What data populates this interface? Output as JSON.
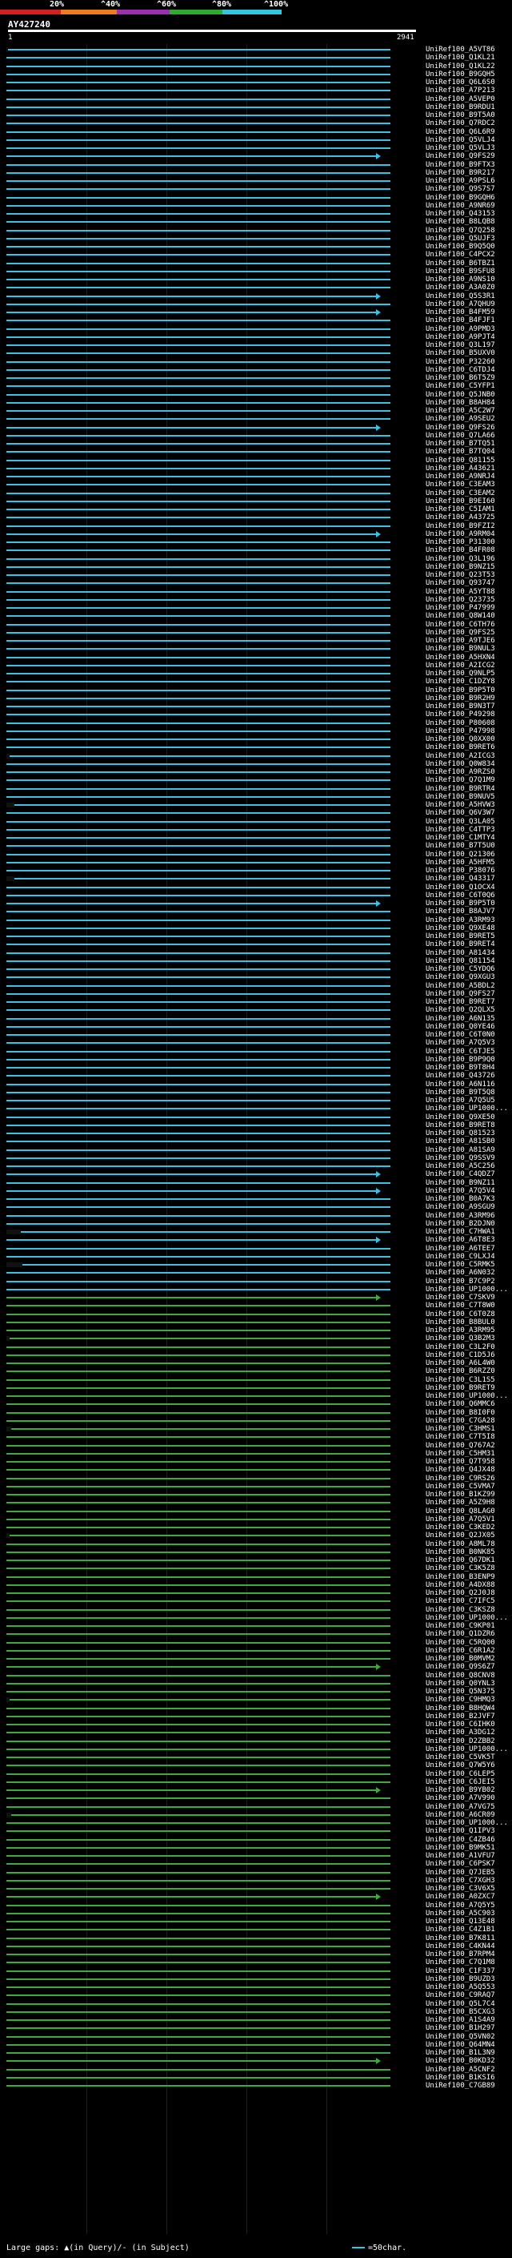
{
  "legend": {
    "labels": [
      "20%",
      "^40%",
      "^60%",
      "^80%",
      "^100%"
    ],
    "colors": [
      "#d81e1e",
      "#f07a1e",
      "#9a2fb0",
      "#2faa2f",
      "#32c6e0"
    ]
  },
  "query": {
    "id": "AY427240",
    "start_tick": "1",
    "end_tick": "2941",
    "length": 2941
  },
  "hits_colors": {
    "high": "#3cc0e6",
    "mid": "#3fa83f"
  },
  "hits": [
    "UniRef100_A5VT86",
    "UniRef100_Q1KL21",
    "UniRef100_Q1KL22",
    "UniRef100_B9GQH5",
    "UniRef100_Q6L6S0",
    "UniRef100_A7P213",
    "UniRef100_A5VEP0",
    "UniRef100_B9RDU1",
    "UniRef100_B9T5A0",
    "UniRef100_Q7RDC2",
    "UniRef100_Q6L6R9",
    "UniRef100_Q5VLJ4",
    "UniRef100_Q5VLJ3",
    "UniRef100_Q9FS29",
    "UniRef100_B9FTX3",
    "UniRef100_B9R217",
    "UniRef100_A9PSL6",
    "UniRef100_Q9S7S7",
    "UniRef100_B9GQH6",
    "UniRef100_A9NR69",
    "UniRef100_Q43153",
    "UniRef100_B8LQB8",
    "UniRef100_Q7Q258",
    "UniRef100_Q5UJF3",
    "UniRef100_B9Q5Q0",
    "UniRef100_C4PCX2",
    "UniRef100_B6TBZ1",
    "UniRef100_B9SFU8",
    "UniRef100_A9NS10",
    "UniRef100_A3A0Z0",
    "UniRef100_Q5S3R1",
    "UniRef100_A7QHU9",
    "UniRef100_B4FM59",
    "UniRef100_B4FJF1",
    "UniRef100_A9PMD3",
    "UniRef100_A9PJT4",
    "UniRef100_Q3L197",
    "UniRef100_B5UXV0",
    "UniRef100_P32260",
    "UniRef100_C6TDJ4",
    "UniRef100_B6T5Z9",
    "UniRef100_C5YFP1",
    "UniRef100_Q5JNB0",
    "UniRef100_B8AH84",
    "UniRef100_A5C2W7",
    "UniRef100_A9SEU2",
    "UniRef100_Q9FS26",
    "UniRef100_Q7LA66",
    "UniRef100_B7TQ51",
    "UniRef100_B7TQ04",
    "UniRef100_Q81155",
    "UniRef100_A43621",
    "UniRef100_A9NRJ4",
    "UniRef100_C3EAM3",
    "UniRef100_C3EAM2",
    "UniRef100_B9EI60",
    "UniRef100_C5IAM1",
    "UniRef100_A43725",
    "UniRef100_B9FZI2",
    "UniRef100_A9RM04",
    "UniRef100_P31300",
    "UniRef100_B4FR08",
    "UniRef100_Q3L196",
    "UniRef100_B9NZ15",
    "UniRef100_Q23T53",
    "UniRef100_Q93747",
    "UniRef100_A5YT88",
    "UniRef100_Q23735",
    "UniRef100_P47999",
    "UniRef100_Q8W140",
    "UniRef100_C6TH76",
    "UniRef100_Q9FS25",
    "UniRef100_A9TJE6",
    "UniRef100_B9NUL3",
    "UniRef100_A5HXN4",
    "UniRef100_A2ICG2",
    "UniRef100_Q9NLP5",
    "UniRef100_C1DZY8",
    "UniRef100_B9P5T0",
    "UniRef100_B9R2H9",
    "UniRef100_B9N3T7",
    "UniRef100_P49298",
    "UniRef100_P80608",
    "UniRef100_P47998",
    "UniRef100_Q0XX00",
    "UniRef100_B9RET6",
    "UniRef100_A2ICG3",
    "UniRef100_Q0W834",
    "UniRef100_A9RZS0",
    "UniRef100_Q7Q1M9",
    "UniRef100_B9RTR4",
    "UniRef100_B9NUV5",
    "UniRef100_A5HVW3",
    "UniRef100_Q6V3W7",
    "UniRef100_Q3LA05",
    "UniRef100_C4TTP3",
    "UniRef100_C1MTY4",
    "UniRef100_B7T5U0",
    "UniRef100_Q21306",
    "UniRef100_A5HFM5",
    "UniRef100_P38076",
    "UniRef100_Q43317",
    "UniRef100_Q1OCX4",
    "UniRef100_C6T0Q6",
    "UniRef100_B9P5T0",
    "UniRef100_B8AJV7",
    "UniRef100_A3RM93",
    "UniRef100_Q9XE48",
    "UniRef100_B9RET5",
    "UniRef100_B9RET4",
    "UniRef100_A81434",
    "UniRef100_Q81154",
    "UniRef100_C5YDQ6",
    "UniRef100_Q9XGU3",
    "UniRef100_A5BDL2",
    "UniRef100_Q9FS27",
    "UniRef100_B9RET7",
    "UniRef100_Q2QLX5",
    "UniRef100_A6N135",
    "UniRef100_Q0YE46",
    "UniRef100_C6T0N0",
    "UniRef100_A7Q5V3",
    "UniRef100_C6TJE5",
    "UniRef100_B9P9Q0",
    "UniRef100_B9T8H4",
    "UniRef100_Q43726",
    "UniRef100_A6N116",
    "UniRef100_B9T5Q8",
    "UniRef100_A7Q5U5",
    "UniRef100_UP1000...",
    "UniRef100_Q9XE50",
    "UniRef100_B9RET8",
    "UniRef100_Q81523",
    "UniRef100_A81SB0",
    "UniRef100_A81SA9",
    "UniRef100_Q9SSV9",
    "UniRef100_A5C256",
    "UniRef100_C4QDZ7",
    "UniRef100_B9NZ11",
    "UniRef100_A7Q5V4",
    "UniRef100_B0A7K3",
    "UniRef100_A9SGU9",
    "UniRef100_A3RM96",
    "UniRef100_B2DJN0",
    "UniRef100_C7HWA1",
    "UniRef100_A6T8E3",
    "UniRef100_A6TEE7",
    "UniRef100_C9LXJ4",
    "UniRef100_C5RMK5",
    "UniRef100_A6N032",
    "UniRef100_B7C9P2",
    "UniRef100_UP1000...",
    "UniRef100_C7SKV9",
    "UniRef100_C7T8W0",
    "UniRef100_C6T0Z8",
    "UniRef100_B8BUL0",
    "UniRef100_A3RM95",
    "UniRef100_Q3B2M3",
    "UniRef100_C3L2F0",
    "UniRef100_C1D5J6",
    "UniRef100_A6L4W0",
    "UniRef100_B6RZZ0",
    "UniRef100_C3L1S5",
    "UniRef100_B9RET9",
    "UniRef100_UP1000...",
    "UniRef100_Q6MMC6",
    "UniRef100_B8I0F0",
    "UniRef100_C7GA28",
    "UniRef100_C3HMS1",
    "UniRef100_C7T5I8",
    "UniRef100_Q767A2",
    "UniRef100_C5HM31",
    "UniRef100_Q7T958",
    "UniRef100_Q4JX48",
    "UniRef100_C9RS26",
    "UniRef100_C5VMA7",
    "UniRef100_B1KZ99",
    "UniRef100_A5Z9H8",
    "UniRef100_Q8LAG0",
    "UniRef100_A7Q5V1",
    "UniRef100_C3KED2",
    "UniRef100_Q2JX05",
    "UniRef100_A8ML78",
    "UniRef100_B0NK85",
    "UniRef100_Q67DK1",
    "UniRef100_C3K5Z8",
    "UniRef100_B3ENP9",
    "UniRef100_A4DX88",
    "UniRef100_Q2J0J8",
    "UniRef100_C7IFC5",
    "UniRef100_C3KSZ8",
    "UniRef100_UP1000...",
    "UniRef100_C9KP01",
    "UniRef100_Q1DZR6",
    "UniRef100_C5RQ00",
    "UniRef100_C6R1A2",
    "UniRef100_B0MVM2",
    "UniRef100_Q9S6Z7",
    "UniRef100_Q8CNV8",
    "UniRef100_Q0YNL3",
    "UniRef100_Q5N375",
    "UniRef100_C9HMQ3",
    "UniRef100_B8HQW4",
    "UniRef100_B2JVF7",
    "UniRef100_C6IHK0",
    "UniRef100_A3DG12",
    "UniRef100_D2ZBB2",
    "UniRef100_UP1000...",
    "UniRef100_C5VK5T",
    "UniRef100_Q7W5Y6",
    "UniRef100_C6LEP5",
    "UniRef100_C6JEI5",
    "UniRef100_B9YB02",
    "UniRef100_A7V990",
    "UniRef100_A7VG75",
    "UniRef100_A6CR09",
    "UniRef100_UP1000...",
    "UniRef100_Q1IPV3",
    "UniRef100_C4ZB46",
    "UniRef100_B9MK51",
    "UniRef100_A1VFU7",
    "UniRef100_C6PSK7",
    "UniRef100_Q7JEB5",
    "UniRef100_C7XGH3",
    "UniRef100_C3V6X5",
    "UniRef100_A0ZXC7",
    "UniRef100_A7Q5Y5",
    "UniRef100_A5C903",
    "UniRef100_Q13E48",
    "UniRef100_C4Z1B1",
    "UniRef100_B7K811",
    "UniRef100_C4KN44",
    "UniRef100_B7RPM4",
    "UniRef100_C7Q1M8",
    "UniRef100_C1F337",
    "UniRef100_B9UZD3",
    "UniRef100_A5Q553",
    "UniRef100_C9RAQ7",
    "UniRef100_Q5L7C4",
    "UniRef100_B5CXG3",
    "UniRef100_A1S4A9",
    "UniRef100_B1H297",
    "UniRef100_Q5VN02",
    "UniRef100_Q64MN4",
    "UniRef100_B1L3N9",
    "UniRef100_B0KD32",
    "UniRef100_A5CNF2",
    "UniRef100_B1KSI6",
    "UniRef100_C7GB89"
  ],
  "footer": {
    "gaps_label": "Large gaps: ▲(in Query)/- (in Subject)",
    "scale_label": "=50char."
  }
}
